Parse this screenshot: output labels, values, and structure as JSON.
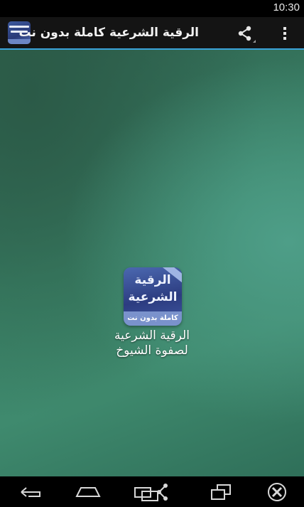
{
  "status_bar": {
    "time": "10:30"
  },
  "action_bar": {
    "title": "الرقية الشرعية كاملة بدون نت",
    "icons": {
      "app": "app-icon",
      "share": "share-icon",
      "menu": "overflow-menu-icon"
    }
  },
  "home": {
    "shortcut": {
      "icon_line1": "الرقية",
      "icon_line2": "الشرعية",
      "icon_band": "كاملة بدون نت",
      "label_line1": "الرقية الشرعية",
      "label_line2": "لصفوة الشيوخ"
    }
  },
  "nav_bar": {
    "icons": [
      "back-icon",
      "home-icon",
      "share-screen-icon",
      "recent-apps-icon",
      "close-icon"
    ]
  },
  "colors": {
    "accent": "#3aa3d9",
    "action_bar": "#141414",
    "background_green": "#3b8468"
  }
}
